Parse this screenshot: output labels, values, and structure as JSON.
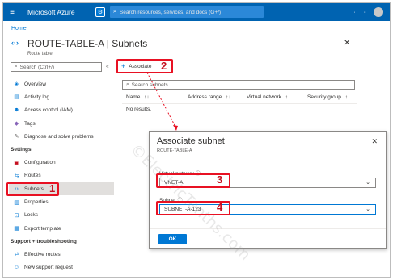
{
  "topbar": {
    "brand": "Microsoft Azure",
    "search_placeholder": "Search resources, services, and docs (G+/)",
    "accent": "#0063b1"
  },
  "breadcrumb": "Home",
  "page": {
    "title": "ROUTE-TABLE-A | Subnets",
    "subtitle": "Route table"
  },
  "sidebar": {
    "search_placeholder": "Search (Ctrl+/)",
    "collapse": "«",
    "items": [
      {
        "icon": "overview-icon",
        "label": "Overview"
      },
      {
        "icon": "activity-log-icon",
        "label": "Activity log"
      },
      {
        "icon": "access-control-icon",
        "label": "Access control (IAM)"
      },
      {
        "icon": "tag-icon",
        "label": "Tags"
      },
      {
        "icon": "wrench-icon",
        "label": "Diagnose and solve problems"
      }
    ],
    "settings_header": "Settings",
    "settings_items": [
      {
        "icon": "configuration-icon",
        "label": "Configuration"
      },
      {
        "icon": "routes-icon",
        "label": "Routes"
      },
      {
        "icon": "subnets-icon",
        "label": "Subnets"
      },
      {
        "icon": "properties-icon",
        "label": "Properties"
      },
      {
        "icon": "lock-icon",
        "label": "Locks"
      },
      {
        "icon": "export-template-icon",
        "label": "Export template"
      }
    ],
    "support_header": "Support + troubleshooting",
    "support_items": [
      {
        "icon": "effective-routes-icon",
        "label": "Effective routes"
      },
      {
        "icon": "support-request-icon",
        "label": "New support request"
      }
    ]
  },
  "main": {
    "associate_label": "Associate",
    "search_placeholder": "Search subnets",
    "columns": [
      "Name",
      "Address range",
      "Virtual network",
      "Security group"
    ],
    "sort_glyph": "↑↓",
    "empty_text": "No results."
  },
  "dialog": {
    "title": "Associate subnet",
    "subtitle": "ROUTE-TABLE-A",
    "vnet_label": "Virtual network",
    "vnet_value": "VNET-A",
    "subnet_label": "Subnet",
    "subnet_value": "SUBNET-A-123",
    "ok_label": "OK"
  },
  "callouts": [
    "1",
    "2",
    "3",
    "4"
  ],
  "watermark": "©ElectricTenths.com",
  "colors": {
    "callout_red": "#e81123",
    "link_blue": "#0078d4"
  }
}
